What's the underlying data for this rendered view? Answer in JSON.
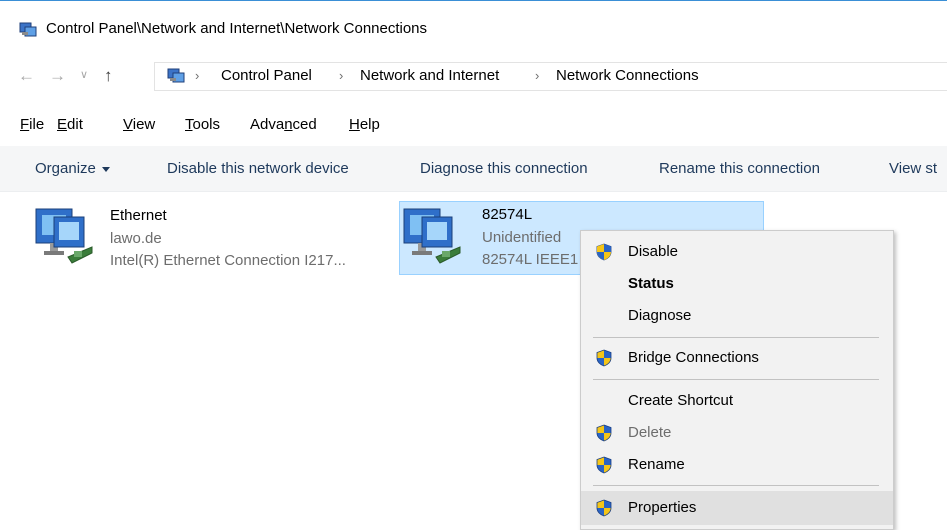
{
  "window": {
    "title": "Control Panel\\Network and Internet\\Network Connections"
  },
  "address_bar": {
    "crumbs": [
      "Control Panel",
      "Network and Internet",
      "Network Connections"
    ]
  },
  "menubar": {
    "items": [
      {
        "accel": "F",
        "rest": "ile"
      },
      {
        "accel": "E",
        "rest": "dit"
      },
      {
        "accel": "V",
        "rest": "iew"
      },
      {
        "accel": "T",
        "rest": "ools"
      },
      {
        "pre": "Adva",
        "accel": "n",
        "rest": "ced"
      },
      {
        "accel": "H",
        "rest": "elp"
      }
    ]
  },
  "command_bar": {
    "organize": "Organize",
    "disable": "Disable this network device",
    "diagnose": "Diagnose this connection",
    "rename": "Rename this connection",
    "view": "View st"
  },
  "connections": [
    {
      "name": "Ethernet",
      "network": "lawo.de",
      "device": "Intel(R) Ethernet Connection I217...",
      "selected": false
    },
    {
      "name": "82574L",
      "network": "Unidentified",
      "device": "82574L IEEE1",
      "selected": true
    }
  ],
  "context_menu": {
    "items": [
      {
        "label": "Disable",
        "icon": "uac-shield-icon",
        "bold": false,
        "disabled": false
      },
      {
        "label": "Status",
        "icon": null,
        "bold": true,
        "disabled": false
      },
      {
        "label": "Diagnose",
        "icon": null,
        "bold": false,
        "disabled": false
      },
      {
        "label": "Bridge Connections",
        "icon": "uac-shield-icon",
        "bold": false,
        "disabled": false
      },
      {
        "label": "Create Shortcut",
        "icon": null,
        "bold": false,
        "disabled": false
      },
      {
        "label": "Delete",
        "icon": "uac-shield-icon",
        "bold": false,
        "disabled": true
      },
      {
        "label": "Rename",
        "icon": "uac-shield-icon",
        "bold": false,
        "disabled": false
      },
      {
        "label": "Properties",
        "icon": "uac-shield-icon",
        "bold": false,
        "disabled": false,
        "highlighted": true
      }
    ]
  },
  "colors": {
    "selection": "#cce8ff",
    "selection_border": "#99d1ff",
    "command_text": "#1e395b",
    "shield_blue": "#2a64c5",
    "shield_yellow": "#f5c518"
  }
}
